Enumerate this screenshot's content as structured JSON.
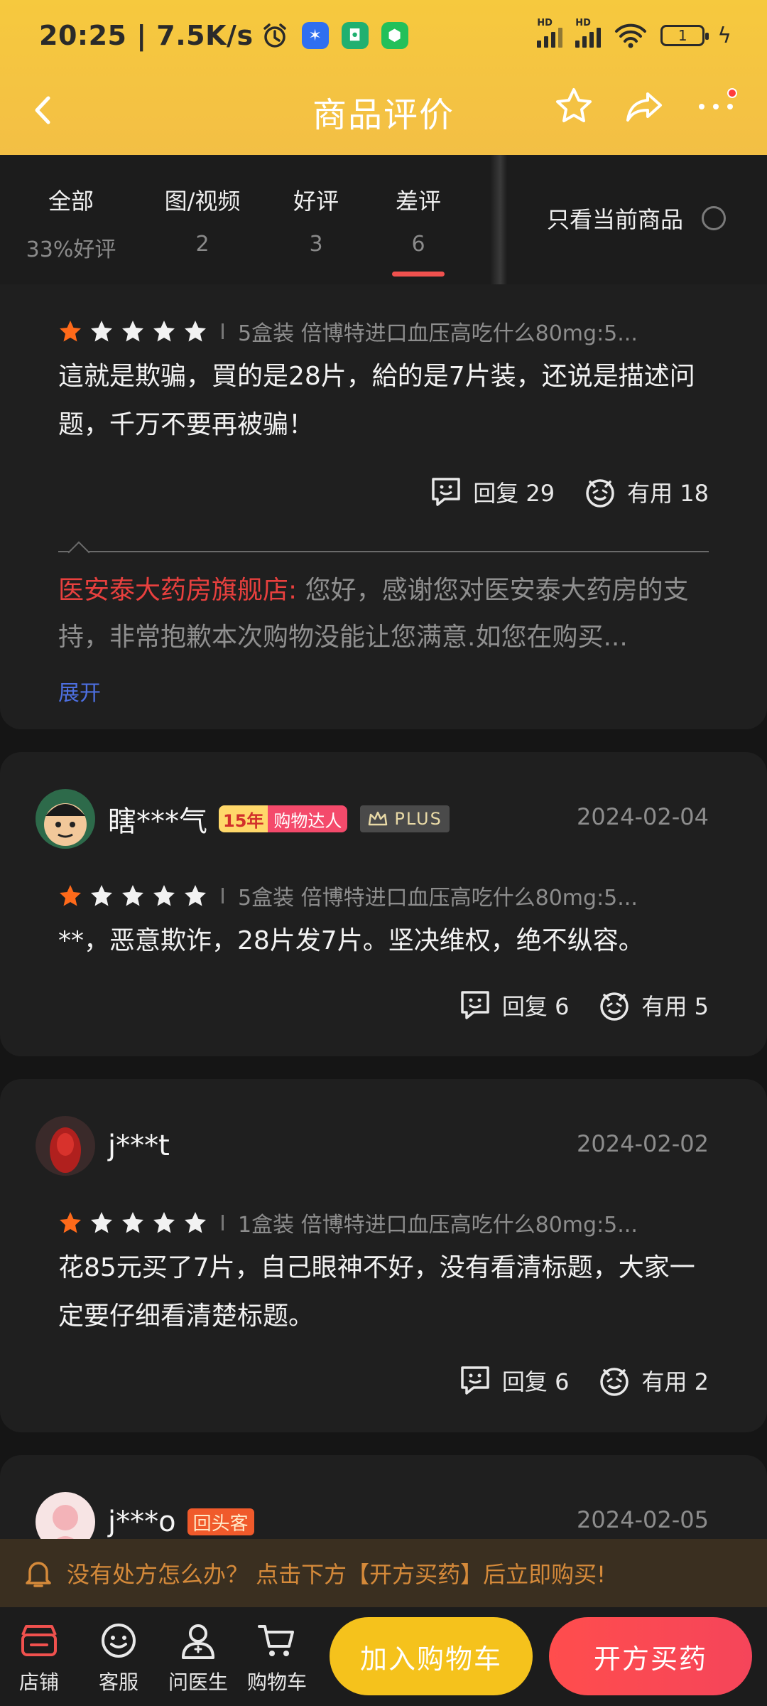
{
  "status_bar": {
    "time": "20:25 | 7.5K/s",
    "battery": "1"
  },
  "header": {
    "title": "商品评价"
  },
  "tabs": [
    {
      "label": "全部",
      "sub": "33%好评"
    },
    {
      "label": "图/视频",
      "sub": "2"
    },
    {
      "label": "好评",
      "sub": "3"
    },
    {
      "label": "差评",
      "sub": "6",
      "active": true
    }
  ],
  "filter": {
    "only_current_label": "只看当前商品"
  },
  "reviews": [
    {
      "rating": 1,
      "spec": "5盒装 倍博特进口血压高吃什么80mg:5...",
      "text": "這就是欺骗，買的是28片，給的是7片装，还说是描述问题，千万不要再被骗！",
      "reply_label": "回复 29",
      "useful_label": "有用 18",
      "seller_reply": {
        "shop": "医安泰大药房旗舰店:",
        "text": " 您好，感谢您对医安泰大药房的支持，非常抱歉本次购物没能让您满意.如您在购买...",
        "expand": "展开"
      }
    },
    {
      "username": "瞎***气",
      "badge_years": "15年",
      "badge_title": "购物达人",
      "badge_plus": "PLUS",
      "date": "2024-02-04",
      "rating": 1,
      "spec": "5盒装 倍博特进口血压高吃什么80mg:5...",
      "text": "**，恶意欺诈，28片发7片。坚决维权，绝不纵容。",
      "reply_label": "回复 6",
      "useful_label": "有用 5"
    },
    {
      "username": "j***t",
      "date": "2024-02-02",
      "rating": 1,
      "spec": "1盒装 倍博特进口血压高吃什么80mg:5...",
      "text": "花85元买了7片，自己眼神不好，没有看清标题，大家一定要仔细看清楚标题。",
      "reply_label": "回复 6",
      "useful_label": "有用 2"
    },
    {
      "username": "j***o",
      "badge_return": "回头客",
      "date": "2024-02-05"
    }
  ],
  "notice": {
    "text": "没有处方怎么办？ 点击下方【开方买药】后立即购买!"
  },
  "bottom_bar": {
    "items": [
      {
        "label": "店铺",
        "icon": "shop-icon"
      },
      {
        "label": "客服",
        "icon": "customer-service-icon"
      },
      {
        "label": "问医生",
        "icon": "doctor-icon"
      },
      {
        "label": "购物车",
        "icon": "cart-icon"
      }
    ],
    "add_to_cart": "加入购物车",
    "prescribe_buy": "开方买药"
  },
  "colors": {
    "header_yellow": "#f6c93e",
    "accent_red": "#f0514e",
    "star_orange": "#ff6a1a",
    "cart_yellow": "#f5c21c",
    "buy_red": "#ff4d4d"
  }
}
